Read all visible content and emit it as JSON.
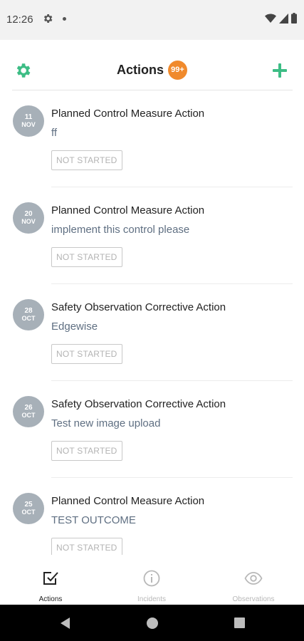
{
  "status_bar": {
    "time": "12:26"
  },
  "header": {
    "title": "Actions",
    "badge": "99+"
  },
  "actions": [
    {
      "day": "11",
      "month": "NOV",
      "title": "Planned Control Measure Action",
      "description": "ff",
      "status": "NOT STARTED"
    },
    {
      "day": "20",
      "month": "NOV",
      "title": "Planned Control Measure Action",
      "description": "implement this control please",
      "status": "NOT STARTED"
    },
    {
      "day": "28",
      "month": "OCT",
      "title": "Safety Observation Corrective Action",
      "description": "Edgewise",
      "status": "NOT STARTED"
    },
    {
      "day": "26",
      "month": "OCT",
      "title": "Safety Observation Corrective Action",
      "description": "Test new image upload",
      "status": "NOT STARTED"
    },
    {
      "day": "25",
      "month": "OCT",
      "title": "Planned Control Measure Action",
      "description": "TEST OUTCOME",
      "status": "NOT STARTED"
    }
  ],
  "bottom_nav": [
    {
      "label": "Actions",
      "icon": "checkbox-icon",
      "active": true
    },
    {
      "label": "Incidents",
      "icon": "info-icon",
      "active": false
    },
    {
      "label": "Observations",
      "icon": "eye-icon",
      "active": false
    }
  ],
  "colors": {
    "accent": "#3dbd85",
    "badge": "#f08a2c",
    "date_circle": "#a7b0b8"
  }
}
